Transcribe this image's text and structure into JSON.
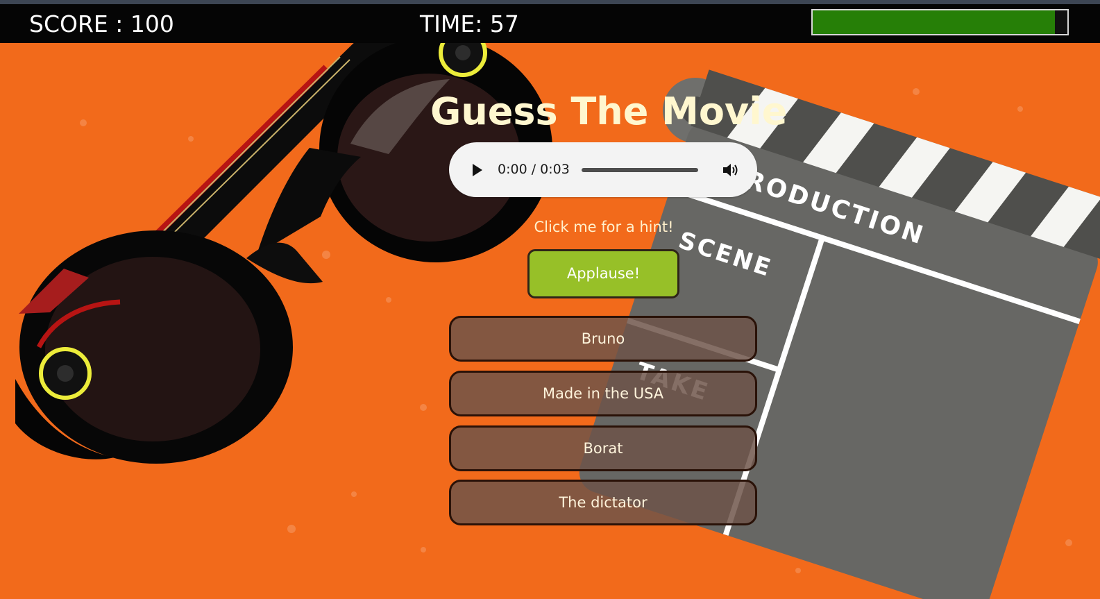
{
  "header": {
    "score_text": "SCORE : 100",
    "time_text": "TIME: 57",
    "time_progress_fraction": 0.95
  },
  "game": {
    "title": "Guess The Movie",
    "audio": {
      "time_display": "0:00 / 0:03",
      "play_icon": "play-icon",
      "volume_icon": "volume-icon",
      "progress_fraction": 0
    },
    "hint_link": "Click me for a hint!",
    "hint_button": "Applause!",
    "answers": [
      "Bruno",
      "Made in the USA",
      "Borat",
      "The dictator"
    ]
  },
  "background": {
    "clapperboard_text": [
      "PRODUCTION",
      "SCENE",
      "TAKE"
    ]
  },
  "colors": {
    "background": "#f26a1b",
    "topbar": "#050505",
    "progress": "#267f07",
    "hint_button": "#97c028",
    "answer_button": "#6e5449",
    "title": "#fff7cf"
  }
}
